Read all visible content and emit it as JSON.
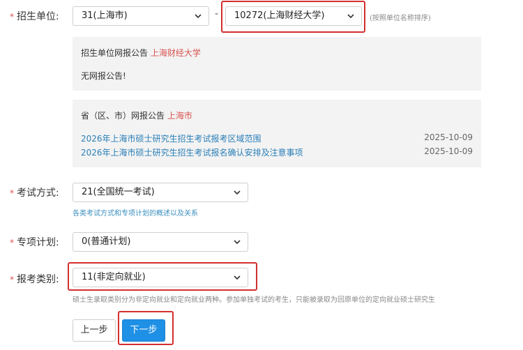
{
  "unit": {
    "required_mark": "*",
    "label": "招生单位:",
    "province_select": "31(上海市)",
    "separator": "-",
    "school_select": "10272(上海财经大学)",
    "sort_hint": "(按照单位名称排序)"
  },
  "school_notice": {
    "title_prefix": "招生单位网报公告",
    "school_name": "上海财经大学",
    "body": "无网报公告!"
  },
  "province_notice": {
    "title_prefix": "省（区、市）网报公告",
    "province_name": "上海市",
    "items": [
      {
        "title": "2026年上海市硕士研究生招生考试报考区域范围",
        "date": "2025-10-09"
      },
      {
        "title": "2026年上海市硕士研究生招生考试报名确认安排及注意事项",
        "date": "2025-10-09"
      }
    ]
  },
  "exam_method": {
    "required_mark": "*",
    "label": "考试方式:",
    "value": "21(全国统一考试)",
    "hint": "各类考试方式和专项计划的概述以及关系"
  },
  "special_plan": {
    "required_mark": "*",
    "label": "专项计划:",
    "value": "0(普通计划)"
  },
  "apply_type": {
    "required_mark": "*",
    "label": "报考类别:",
    "value": "11(非定向就业)",
    "hint": "硕士生录取类别分为非定向就业和定向就业两种。参加单独考试的考生，只能被录取为回原单位的定向就业硕士研究生"
  },
  "buttons": {
    "prev": "上一步",
    "next": "下一步"
  },
  "colors": {
    "accent_red": "#d32f2f",
    "required_star": "#e05050",
    "link_blue": "#2a7fb8",
    "primary_button": "#1e90e6",
    "panel_bg": "#f3f3f3"
  }
}
